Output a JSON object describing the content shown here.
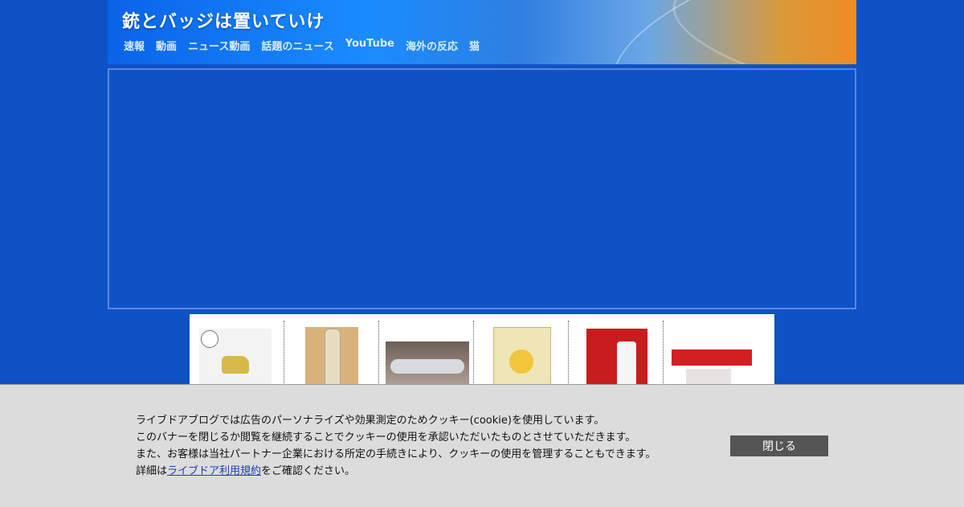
{
  "header": {
    "site_title": "銃とバッジは置いていけ",
    "nav": [
      "速報",
      "動画",
      "ニュース動画",
      "話題のニュース",
      "YouTube",
      "海外の反応",
      "猫"
    ]
  },
  "colors": {
    "page_background": "#0f52c5",
    "cookie_banner": "#dcdcdc",
    "close_button": "#555555",
    "link": "#1a3fb0"
  },
  "products": [
    {
      "icon": "dog-figure-product-icon"
    },
    {
      "icon": "wine-bottle-product-icon"
    },
    {
      "icon": "train-model-product-icon"
    },
    {
      "icon": "tea-beans-product-icon"
    },
    {
      "icon": "rust-remover-product-icon"
    },
    {
      "icon": "toy-train-product-icon"
    }
  ],
  "cookie": {
    "line1": "ライブドアブログでは広告のパーソナライズや効果測定のためクッキー(cookie)を使用しています。",
    "line2": "このバナーを閉じるか閲覧を継続することでクッキーの使用を承認いただいたものとさせていただきます。",
    "line3": "また、お客様は当社パートナー企業における所定の手続きにより、クッキーの使用を管理することもできます。",
    "line4_prefix": "詳細は",
    "line4_link": "ライブドア利用規約",
    "line4_suffix": "をご確認ください。",
    "close_label": "閉じる"
  }
}
